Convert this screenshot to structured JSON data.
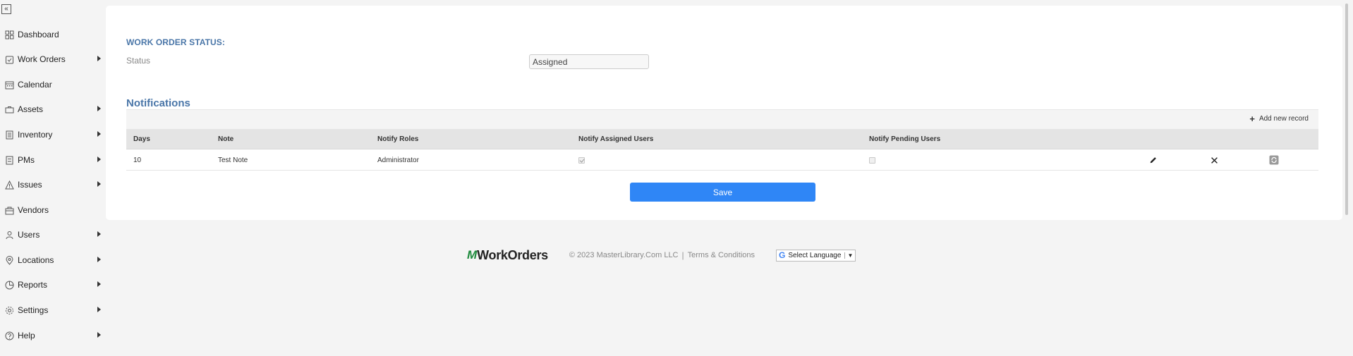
{
  "sidebar": {
    "collapse_icon": "double-chevron-left-icon",
    "items": [
      {
        "label": "Dashboard",
        "icon": "grid-icon",
        "has_submenu": false
      },
      {
        "label": "Work Orders",
        "icon": "clipboard-icon",
        "has_submenu": true
      },
      {
        "label": "Calendar",
        "icon": "calendar-icon",
        "has_submenu": false
      },
      {
        "label": "Assets",
        "icon": "briefcase-icon",
        "has_submenu": true
      },
      {
        "label": "Inventory",
        "icon": "document-icon",
        "has_submenu": true
      },
      {
        "label": "PMs",
        "icon": "checklist-icon",
        "has_submenu": true
      },
      {
        "label": "Issues",
        "icon": "warning-icon",
        "has_submenu": true
      },
      {
        "label": "Vendors",
        "icon": "store-icon",
        "has_submenu": false
      },
      {
        "label": "Users",
        "icon": "user-icon",
        "has_submenu": true
      },
      {
        "label": "Locations",
        "icon": "pin-icon",
        "has_submenu": true
      },
      {
        "label": "Reports",
        "icon": "chart-icon",
        "has_submenu": true
      },
      {
        "label": "Settings",
        "icon": "gear-icon",
        "has_submenu": true
      },
      {
        "label": "Help",
        "icon": "question-icon",
        "has_submenu": true
      }
    ]
  },
  "form": {
    "section_title": "WORK ORDER STATUS:",
    "status_label": "Status",
    "status_value": "Assigned"
  },
  "notifications": {
    "title": "Notifications",
    "add_label": "Add new record",
    "columns": [
      "Days",
      "Note",
      "Notify Roles",
      "Notify Assigned Users",
      "Notify Pending Users"
    ],
    "rows": [
      {
        "days": "10",
        "note": "Test Note",
        "roles": "Administrator",
        "notify_assigned": true,
        "notify_pending": false
      }
    ]
  },
  "save_label": "Save",
  "footer": {
    "logo_text": "WorkOrders",
    "copyright": "© 2023 MasterLibrary.Com LLC",
    "separator": "|",
    "terms": "Terms & Conditions",
    "language_label": "Select Language",
    "language_arrow": "▼"
  }
}
